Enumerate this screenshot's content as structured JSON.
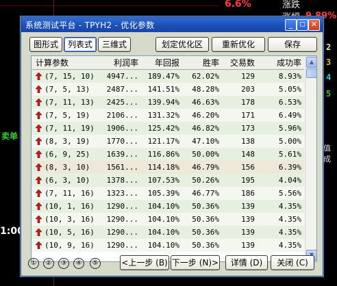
{
  "background": {
    "pct": "6.6%",
    "pct2": "9.89%",
    "label_rise": "涨跌",
    "label_amp": "涨幅",
    "side_label": "卖单",
    "right_label": "值成",
    "time": "1:00",
    "nums_right": [
      "2",
      "3",
      "4",
      "5"
    ]
  },
  "dialog": {
    "title": "系统测试平台 - TPYH2 - 优化参数",
    "min": "_",
    "max": "□",
    "close": "✕",
    "view_tabs": [
      "图形式",
      "列表式",
      "三维式"
    ],
    "actions": [
      "划定优化区",
      "重新优化",
      "保存"
    ],
    "columns": [
      "计算参数",
      "利润率",
      "年回报",
      "胜率",
      "交易数",
      "成功率"
    ],
    "rows": [
      [
        "(7, 15, 10)",
        "4947...",
        "189.47%",
        "62.02%",
        "129",
        "8.93%"
      ],
      [
        "(7, 5, 13)",
        "2487...",
        "141.51%",
        "48.28%",
        "203",
        "5.05%"
      ],
      [
        "(7, 11, 13)",
        "2425...",
        "139.94%",
        "46.63%",
        "178",
        "6.53%"
      ],
      [
        "(7, 5, 19)",
        "2106...",
        "131.32%",
        "46.20%",
        "171",
        "6.49%"
      ],
      [
        "(7, 11, 19)",
        "1906...",
        "125.42%",
        "46.82%",
        "173",
        "5.96%"
      ],
      [
        "(8, 3, 19)",
        "1770...",
        "121.17%",
        "47.10%",
        "138",
        "5.00%"
      ],
      [
        "(6, 9, 25)",
        "1639...",
        "116.86%",
        "50.00%",
        "148",
        "5.61%"
      ],
      [
        "(8, 3, 10)",
        "1561...",
        "114.18%",
        "46.79%",
        "156",
        "6.39%"
      ],
      [
        "(6, 3, 10)",
        "1378...",
        "107.53%",
        "50.26%",
        "195",
        "4.04%"
      ],
      [
        "(7, 11, 16)",
        "1323...",
        "105.39%",
        "46.77%",
        "186",
        "5.56%"
      ],
      [
        "(10, 1, 16)",
        "1290...",
        "104.10%",
        "50.36%",
        "139",
        "4.35%"
      ],
      [
        "(10, 3, 16)",
        "1290...",
        "104.10%",
        "50.36%",
        "139",
        "4.35%"
      ],
      [
        "(10, 5, 16)",
        "1290...",
        "104.10%",
        "50.36%",
        "139",
        "4.35%"
      ],
      [
        "(10, 9, 16)",
        "1290...",
        "104.10%",
        "50.36%",
        "139",
        "4.35%"
      ]
    ],
    "pages": [
      "①",
      "②",
      "③",
      "④",
      "⑤"
    ],
    "footer": [
      "<上一步 (B)",
      "下一步 (N)>",
      "详情 (D)",
      "关闭 (C)"
    ]
  }
}
